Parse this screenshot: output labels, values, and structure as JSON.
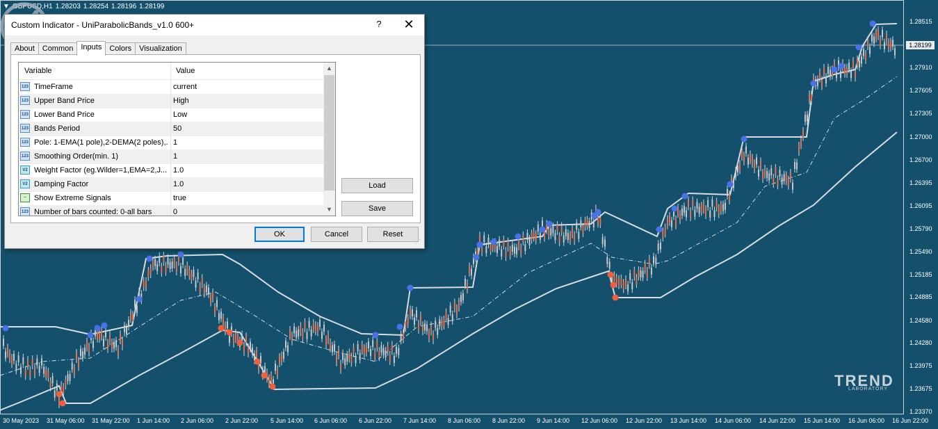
{
  "chart": {
    "symbol": "GBPUSD,H1",
    "quotes": [
      "1.28203",
      "1.28254",
      "1.28196",
      "1.28199"
    ],
    "current_price": "1.28199",
    "price_labels": [
      "1.28515",
      "1.27910",
      "1.27605",
      "1.27305",
      "1.27000",
      "1.26700",
      "1.26395",
      "1.26095",
      "1.25790",
      "1.25490",
      "1.25185",
      "1.24885",
      "1.24580",
      "1.24280",
      "1.23975",
      "1.23675",
      "1.23370"
    ],
    "time_labels": [
      "30 May 2023",
      "31 May 06:00",
      "31 May 22:00",
      "1 Jun 14:00",
      "2 Jun 06:00",
      "2 Jun 22:00",
      "5 Jun 14:00",
      "6 Jun 06:00",
      "6 Jun 22:00",
      "7 Jun 14:00",
      "8 Jun 06:00",
      "8 Jun 22:00",
      "9 Jun 14:00",
      "12 Jun 06:00",
      "12 Jun 22:00",
      "13 Jun 14:00",
      "14 Jun 06:00",
      "14 Jun 22:00",
      "15 Jun 14:00",
      "16 Jun 06:00",
      "16 Jun 22:00"
    ],
    "colors": {
      "background": "#14506b",
      "upper_band": "#d7dde2",
      "lower_band": "#d7dde2",
      "up_signal": "#4a72e8",
      "down_signal": "#f0603f",
      "candle_up": "#c8c8c8",
      "candle_down": "#e07050"
    }
  },
  "logo": {
    "brand": "TREND",
    "sub": "LABORATORY"
  },
  "dialog": {
    "title": "Custom Indicator - UniParabolicBands_v1.0 600+",
    "help": "?",
    "close": "✕",
    "tabs": [
      "About",
      "Common",
      "Inputs",
      "Colors",
      "Visualization"
    ],
    "active_tab": "Inputs",
    "columns": {
      "variable": "Variable",
      "value": "Value"
    },
    "rows": [
      {
        "icon": "123",
        "variable": "TimeFrame",
        "value": "current"
      },
      {
        "icon": "123",
        "variable": "Upper Band Price",
        "value": "High"
      },
      {
        "icon": "123",
        "variable": "Lower Band Price",
        "value": "Low"
      },
      {
        "icon": "123",
        "variable": "Bands Period",
        "value": "50"
      },
      {
        "icon": "123",
        "variable": "Pole: 1-EMA(1 pole),2-DEMA(2 poles),...",
        "value": "1"
      },
      {
        "icon": "123",
        "variable": "Smoothing Order(min. 1)",
        "value": "1"
      },
      {
        "icon": "V2",
        "variable": "Weight Factor (eg.Wilder=1,EMA=2,J...",
        "value": "1.0"
      },
      {
        "icon": "V2",
        "variable": "Damping Factor",
        "value": "1.0"
      },
      {
        "icon": "signal",
        "variable": "Show Extreme Signals",
        "value": "true"
      },
      {
        "icon": "123",
        "variable": "Number of bars counted: 0-all bars",
        "value": "0"
      }
    ],
    "buttons": {
      "load": "Load",
      "save": "Save",
      "ok": "OK",
      "cancel": "Cancel",
      "reset": "Reset"
    }
  }
}
